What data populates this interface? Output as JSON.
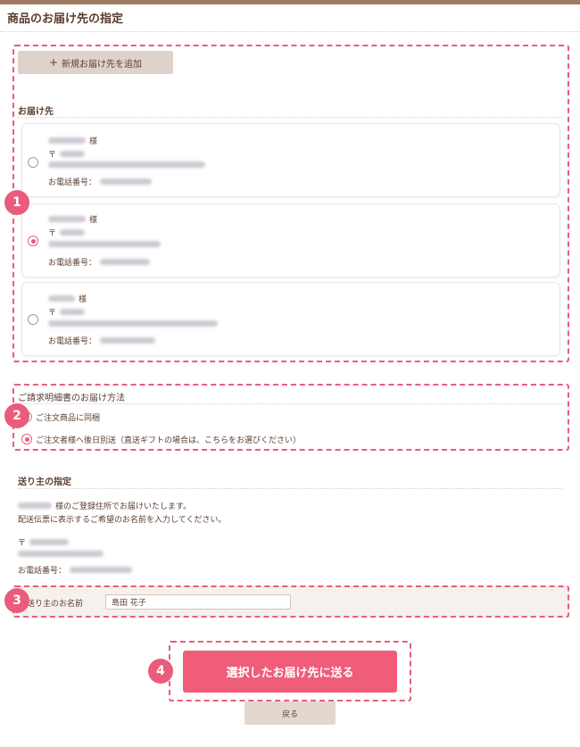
{
  "page": {
    "title": "商品のお届け先の指定"
  },
  "colors": {
    "accent": "#e95c7b",
    "brown": "#5a3e30",
    "button_beige": "#dfd2cb"
  },
  "shipping": {
    "add_button": {
      "icon": "plus-icon",
      "label": "新規お届け先を追加"
    },
    "section_label": "お届け先",
    "addresses": [
      {
        "suffix": "様",
        "postal_mark": "〒",
        "phone_label": "お電話番号：",
        "selected": false
      },
      {
        "suffix": "様",
        "postal_mark": "〒",
        "phone_label": "お電話番号：",
        "selected": true
      },
      {
        "suffix": "様",
        "postal_mark": "〒",
        "phone_label": "お電話番号：",
        "selected": false
      }
    ]
  },
  "invoice": {
    "section_label": "ご請求明細書のお届け方法",
    "options": [
      {
        "label": "ご注文商品に同梱",
        "selected": false
      },
      {
        "label": "ご注文者様へ後日別送（直送ギフトの場合は、こちらをお選びください）",
        "selected": true
      }
    ]
  },
  "sender": {
    "section_label": "送り主の指定",
    "line1_suffix": "様のご登録住所でお届けいたします。",
    "line2": "配送伝票に表示するご希望のお名前を入力してください。",
    "postal_mark": "〒",
    "phone_label": "お電話番号：",
    "name_label": "送り主のお名前",
    "name_value": "島田 花子"
  },
  "actions": {
    "submit_label": "選択したお届け先に送る",
    "back_label": "戻る"
  },
  "badges": [
    "1",
    "2",
    "3",
    "4"
  ]
}
